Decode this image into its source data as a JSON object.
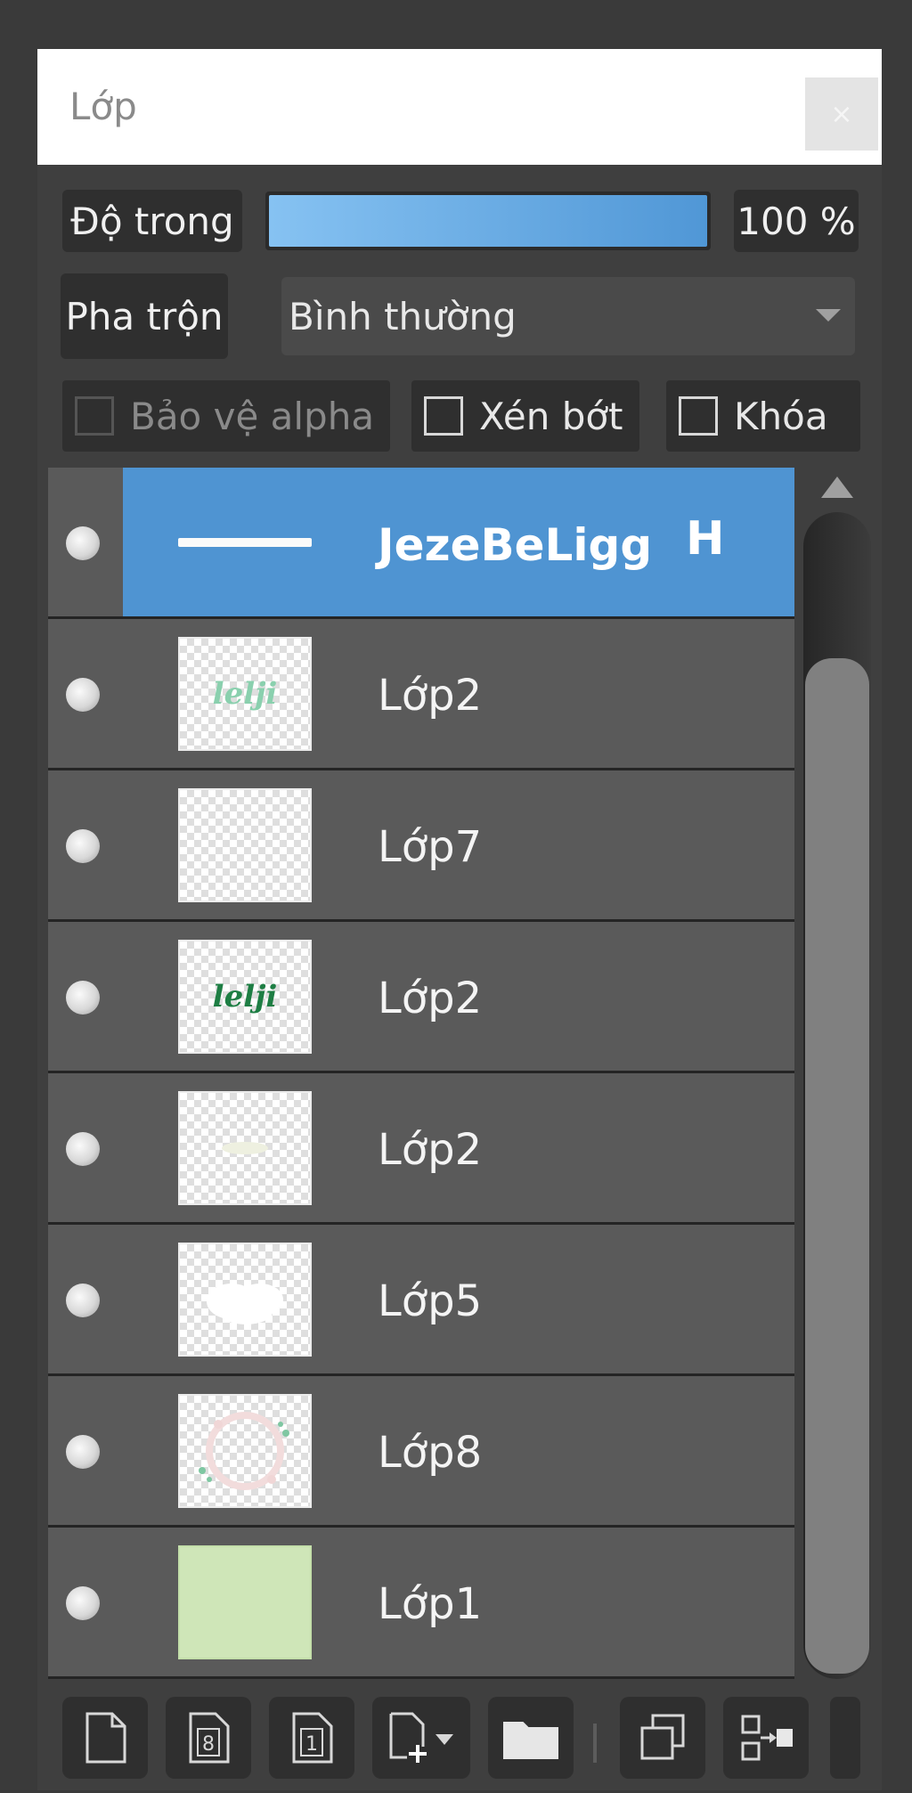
{
  "panel": {
    "title": "Lớp",
    "close_label": "×"
  },
  "opacity": {
    "label": "Độ trong",
    "value": "100 %",
    "level_percent": 100
  },
  "blend": {
    "label": "Pha trộn",
    "value": "Bình thường"
  },
  "checkboxes": {
    "alpha_protect": {
      "label": "Bảo vệ alpha",
      "checked": false,
      "enabled": false
    },
    "clipping": {
      "label": "Xén bớt",
      "checked": false,
      "enabled": true
    },
    "lock": {
      "label": "Khóa",
      "checked": false,
      "enabled": true
    }
  },
  "layers": [
    {
      "name": "JezeBeLigg",
      "extra": "H",
      "selected": true,
      "visible": true,
      "thumb": "text-line"
    },
    {
      "name": "Lớp2",
      "visible": true,
      "thumb": "mint",
      "thumb_text": "lelji"
    },
    {
      "name": "Lớp7",
      "visible": true,
      "thumb": "empty"
    },
    {
      "name": "Lớp2",
      "visible": true,
      "thumb": "green",
      "thumb_text": "lelji"
    },
    {
      "name": "Lớp2",
      "visible": true,
      "thumb": "faint"
    },
    {
      "name": "Lớp5",
      "visible": true,
      "thumb": "white"
    },
    {
      "name": "Lớp8",
      "visible": true,
      "thumb": "wreath"
    },
    {
      "name": "Lớp1",
      "visible": true,
      "thumb": "solid"
    }
  ],
  "toolbar": {
    "buttons": [
      {
        "icon": "new-layer-icon"
      },
      {
        "icon": "new-8bit-layer-icon",
        "glyph": "8"
      },
      {
        "icon": "new-1bit-layer-icon",
        "glyph": "1"
      },
      {
        "icon": "add-layer-dropdown-icon"
      },
      {
        "icon": "new-folder-icon"
      },
      {
        "icon": "duplicate-layer-icon"
      },
      {
        "icon": "merge-layer-icon"
      }
    ]
  },
  "colors": {
    "selected_row": "#4f94d2",
    "opacity_fill_start": "#86c2f2",
    "opacity_fill_end": "#5097d6",
    "row_bg": "#5a5a5a",
    "panel_bg": "#3f3f3f"
  }
}
